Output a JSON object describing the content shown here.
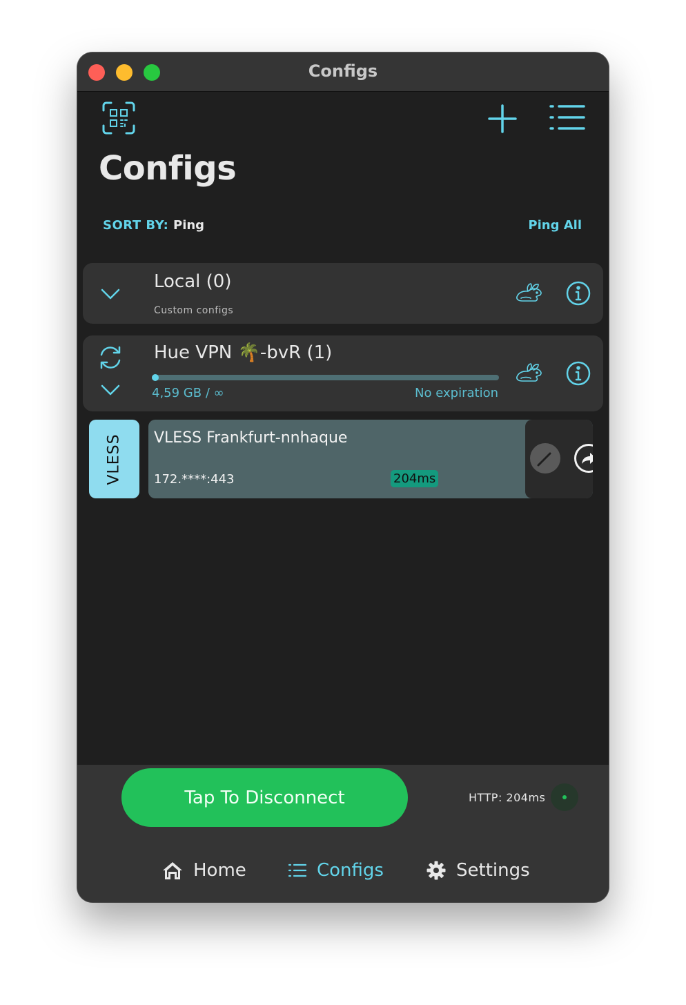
{
  "window": {
    "title": "Configs"
  },
  "toolbar": {
    "scan_icon": "qr-scan-icon",
    "add_icon": "plus-icon",
    "list_icon": "list-icon"
  },
  "page": {
    "title": "Configs"
  },
  "sort": {
    "label": "SORT BY:",
    "value": "Ping",
    "ping_all": "Ping All"
  },
  "groups": [
    {
      "name": "Local (0)",
      "subtitle": "Custom configs"
    },
    {
      "name": "Hue VPN 🌴-bvR (1)",
      "usage": "4,59 GB / ∞",
      "expiry": "No expiration",
      "usage_fraction": 0.01
    }
  ],
  "configs": [
    {
      "protocol": "VLESS",
      "name": "VLESS Frankfurt-nnhaque",
      "address": "172.****:443",
      "ping": "204ms"
    }
  ],
  "connection": {
    "button_label": "Tap To Disconnect",
    "http_status": "HTTP: 204ms"
  },
  "nav": {
    "home": "Home",
    "configs": "Configs",
    "settings": "Settings"
  },
  "colors": {
    "accent": "#62d4ea",
    "connect_green": "#22c15a",
    "background": "#1f1f1f",
    "card": "#333333",
    "config_card": "#4f6568",
    "ping_badge": "#149a7e"
  }
}
